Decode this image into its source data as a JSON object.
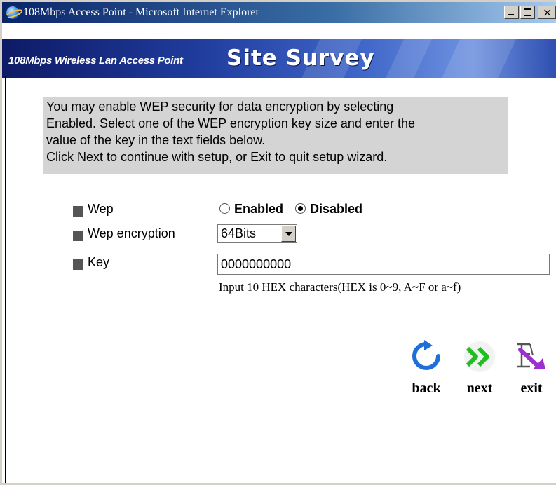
{
  "window": {
    "title": "108Mbps Access Point - Microsoft Internet Explorer"
  },
  "banner": {
    "subtitle": "108Mbps Wireless Lan Access Point",
    "title": "Site Survey"
  },
  "notice": {
    "lines": [
      "You may enable WEP security for data encryption by selecting",
      "Enabled. Select one of the WEP encryption key size and enter the",
      "value of the key in the text fields below.",
      "Click Next to continue with setup, or Exit to quit setup wizard."
    ]
  },
  "form": {
    "wep_label": "Wep",
    "wep_options": [
      "Enabled",
      "Disabled"
    ],
    "wep_selected": "Disabled",
    "encryption_label": "Wep encryption",
    "encryption_value": "64Bits",
    "key_label": "Key",
    "key_value": "0000000000",
    "key_hint": "Input 10 HEX characters(HEX is 0~9, A~F or a~f)"
  },
  "nav": {
    "back_label": "back",
    "next_label": "next",
    "exit_label": "exit"
  },
  "colors": {
    "titlebar": "#0a246a",
    "banner": "#1f3c9c",
    "notice_bg": "#d4d4d4",
    "back_icon": "#1e6fd9",
    "next_icon": "#1fbf1f",
    "exit_icon": "#9b2fcf"
  }
}
